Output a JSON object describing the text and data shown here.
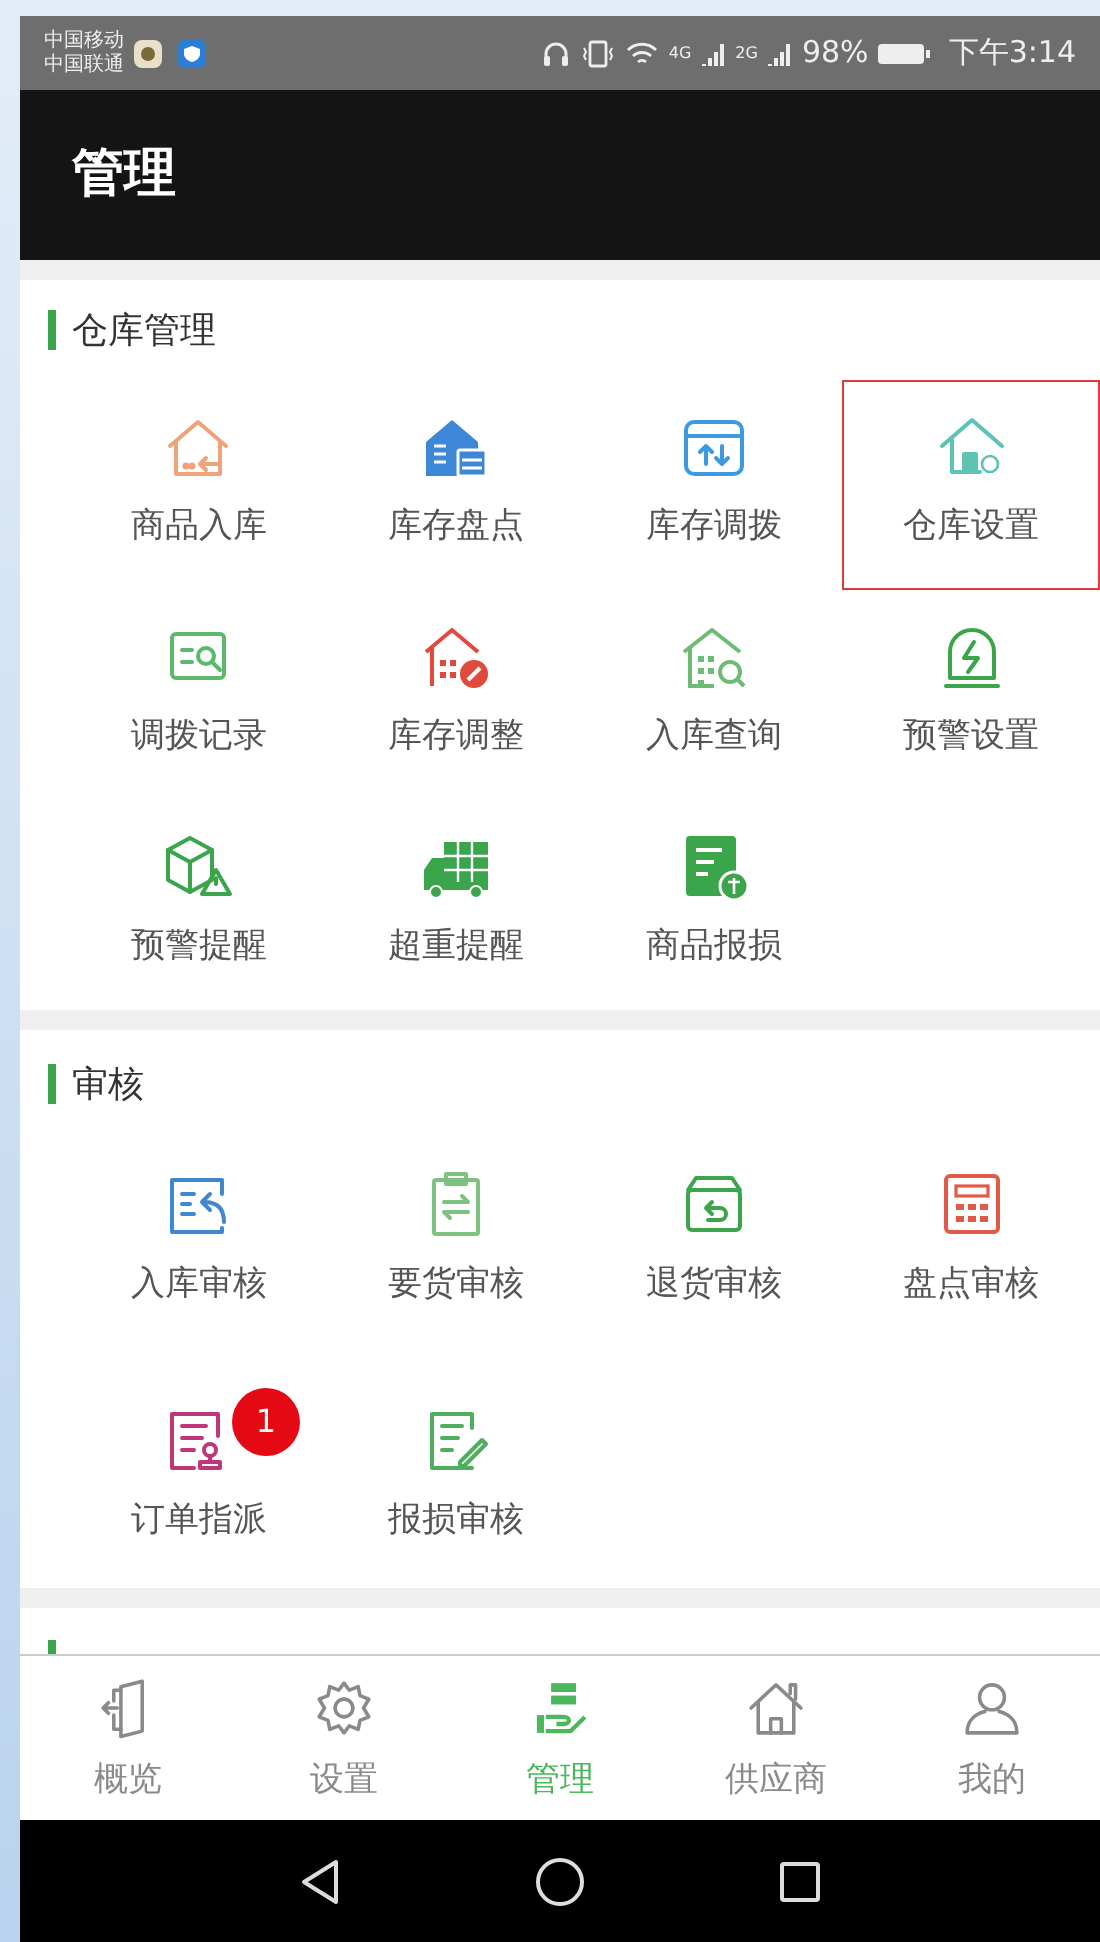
{
  "status_bar": {
    "carriers": [
      "中国移动",
      "中国联通"
    ],
    "network_1": "4G",
    "network_2": "2G",
    "battery": "98%",
    "time": "下午3:14"
  },
  "header": {
    "title": "管理"
  },
  "sections": [
    {
      "title": "仓库管理",
      "items": [
        {
          "label": "商品入库",
          "highlighted": false
        },
        {
          "label": "库存盘点",
          "highlighted": false
        },
        {
          "label": "库存调拨",
          "highlighted": false
        },
        {
          "label": "仓库设置",
          "highlighted": true
        },
        {
          "label": "调拨记录",
          "highlighted": false
        },
        {
          "label": "库存调整",
          "highlighted": false
        },
        {
          "label": "入库查询",
          "highlighted": false
        },
        {
          "label": "预警设置",
          "highlighted": false
        },
        {
          "label": "预警提醒",
          "highlighted": false
        },
        {
          "label": "超重提醒",
          "highlighted": false
        },
        {
          "label": "商品报损",
          "highlighted": false
        }
      ]
    },
    {
      "title": "审核",
      "items": [
        {
          "label": "入库审核",
          "highlighted": false
        },
        {
          "label": "要货审核",
          "highlighted": false
        },
        {
          "label": "退货审核",
          "highlighted": false
        },
        {
          "label": "盘点审核",
          "highlighted": false
        },
        {
          "label": "订单指派",
          "highlighted": false,
          "badge": "1"
        },
        {
          "label": "报损审核",
          "highlighted": false
        }
      ]
    }
  ],
  "bottom_tabs": [
    {
      "label": "概览",
      "selected": false
    },
    {
      "label": "设置",
      "selected": false
    },
    {
      "label": "管理",
      "selected": true
    },
    {
      "label": "供应商",
      "selected": false
    },
    {
      "label": "我的",
      "selected": false
    }
  ]
}
